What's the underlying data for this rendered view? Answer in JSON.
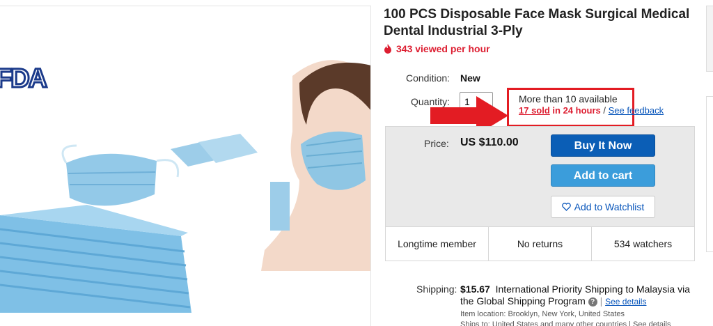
{
  "product": {
    "title": "100 PCS Disposable Face Mask Surgical Medical Dental Industrial 3-Ply",
    "views": "343 viewed per hour",
    "fda_logo_text": "FDA"
  },
  "details": {
    "condition_label": "Condition:",
    "condition_value": "New",
    "quantity_label": "Quantity:",
    "quantity_value": "1",
    "availability": "More than 10 available",
    "sold_link": "17 sold",
    "sold_suffix": " in 24 hours",
    "separator": " / ",
    "feedback_link": "See feedback"
  },
  "buy": {
    "price_label": "Price:",
    "price": "US $110.00",
    "buy_now": "Buy It Now",
    "add_to_cart": "Add to cart",
    "watchlist": "Add to Watchlist"
  },
  "stats": [
    "Longtime member",
    "No returns",
    "534 watchers"
  ],
  "shipping": {
    "label": "Shipping:",
    "cost": "$15.67",
    "desc": "International Priority Shipping to Malaysia via the Global Shipping Program",
    "see_details": "See details",
    "item_location": "Item location:  Brooklyn, New York, United States",
    "ships_to": "Ships to:  United States and many other countries | See details"
  },
  "colors": {
    "accent_red": "#dd1e31",
    "buy_blue": "#0b5eb6",
    "cart_blue": "#3b9ddb",
    "link_blue": "#0654ba"
  }
}
